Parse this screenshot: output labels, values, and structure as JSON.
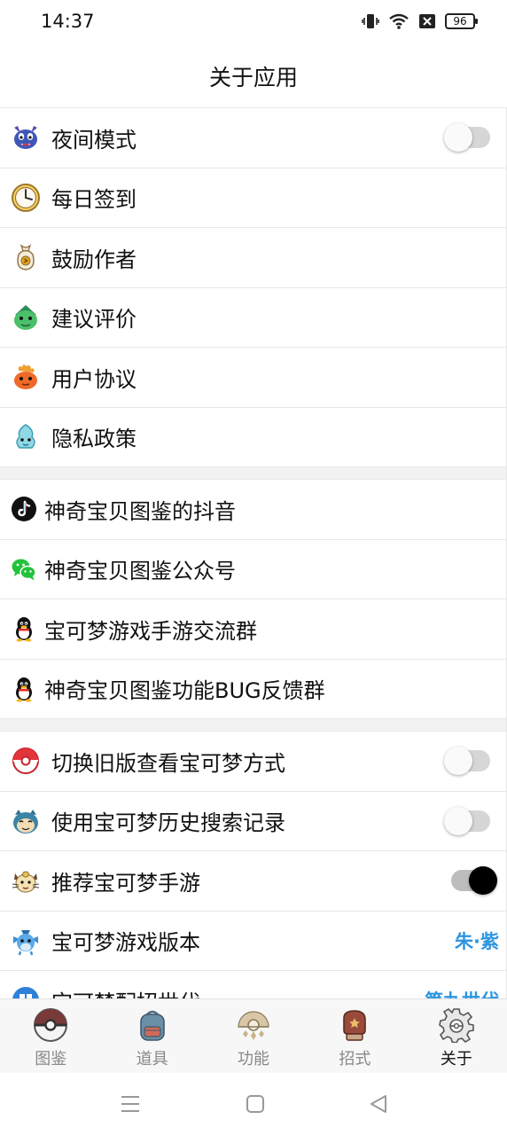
{
  "status_bar": {
    "time": "14:37",
    "battery": "96"
  },
  "header": {
    "title": "关于应用"
  },
  "settings": [
    {
      "label": "夜间模式",
      "icon": "ghost-bat-icon",
      "toggle": "off"
    },
    {
      "label": "每日签到",
      "icon": "clock-icon"
    },
    {
      "label": "鼓励作者",
      "icon": "money-bag-icon"
    },
    {
      "label": "建议评价",
      "icon": "green-pokemon-icon"
    },
    {
      "label": "用户协议",
      "icon": "fire-pokemon-icon"
    },
    {
      "label": "隐私政策",
      "icon": "water-pokemon-icon"
    }
  ],
  "social": [
    {
      "label": "神奇宝贝图鉴的抖音",
      "icon": "tiktok-icon"
    },
    {
      "label": "神奇宝贝图鉴公众号",
      "icon": "wechat-icon"
    },
    {
      "label": "宝可梦游戏手游交流群",
      "icon": "qq-penguin-icon"
    },
    {
      "label": "神奇宝贝图鉴功能BUG反馈群",
      "icon": "qq-penguin-icon"
    }
  ],
  "options": [
    {
      "label": "切换旧版查看宝可梦方式",
      "icon": "pokeball-icon",
      "toggle": "off"
    },
    {
      "label": "使用宝可梦历史搜索记录",
      "icon": "snorlax-icon",
      "toggle": "off"
    },
    {
      "label": "推荐宝可梦手游",
      "icon": "meowth-icon",
      "toggle": "on"
    },
    {
      "label": "宝可梦游戏版本",
      "icon": "dragon-icon",
      "value": "朱·紫"
    },
    {
      "label": "宝可梦配招世代",
      "icon": "blue-badge-icon",
      "value": "第九世代"
    }
  ],
  "tabs": [
    {
      "label": "图鉴",
      "icon": "pokeball-tab-icon",
      "active": false
    },
    {
      "label": "道具",
      "icon": "backpack-tab-icon",
      "active": false
    },
    {
      "label": "功能",
      "icon": "feature-tab-icon",
      "active": false
    },
    {
      "label": "招式",
      "icon": "boxing-glove-tab-icon",
      "active": false
    },
    {
      "label": "关于",
      "icon": "gear-tab-icon",
      "active": true
    }
  ],
  "colors": {
    "accent_value": "#2d95e0",
    "toggle_on_knob": "#000000",
    "section_gap": "#f2f2f2"
  }
}
